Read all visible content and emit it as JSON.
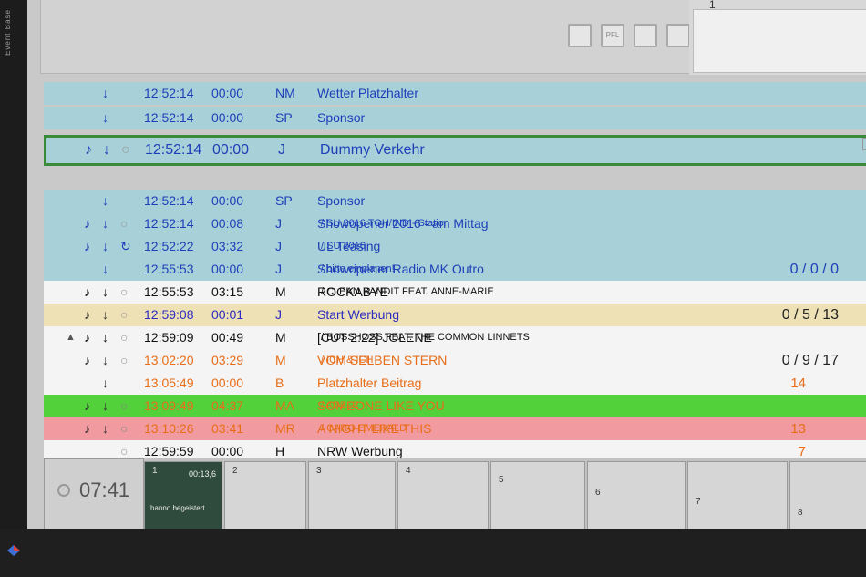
{
  "side_label": "Event Base",
  "top_buttons": [
    "",
    "PFL",
    "",
    ""
  ],
  "top_right_number": "1",
  "rows": [
    {
      "start": "12:52:14",
      "dur": "00:00",
      "type": "NM",
      "title": "Wetter Platzhalter",
      "artist": "",
      "count": ""
    },
    {
      "start": "12:52:14",
      "dur": "00:00",
      "type": "SP",
      "title": "Sponsor",
      "artist": "",
      "count": ""
    },
    {
      "start": "12:52:14",
      "dur": "00:00",
      "type": "J",
      "title": "Dummy Verkehr",
      "artist": "",
      "count": ""
    },
    {
      "start": "12:52:14",
      "dur": "00:00",
      "type": "SP",
      "title": "Sponsor",
      "artist": "",
      "count": ""
    },
    {
      "start": "12:52:14",
      "dur": "00:08",
      "type": "J",
      "title": "Showopener 2016 - am Mittag",
      "artist": "/ SU 2016 TOH/IND - Station",
      "count": ""
    },
    {
      "start": "12:52:22",
      "dur": "03:32",
      "type": "J",
      "title": "UL Teasing",
      "artist": "/ SU 2016",
      "count": ""
    },
    {
      "start": "12:55:53",
      "dur": "00:00",
      "type": "J",
      "title": "Showopener Radio MK Outro",
      "artist": "/ bitte einplanen!",
      "count": "0 / 0 / 0"
    },
    {
      "start": "12:55:53",
      "dur": "03:15",
      "type": "M",
      "title": "ROCKABYE",
      "artist": "/ CLEAN BANDIT FEAT. ANNE-MARIE",
      "count": ""
    },
    {
      "start": "12:59:08",
      "dur": "00:01",
      "type": "J",
      "title": "Start Werbung",
      "artist": "",
      "count": "0 / 5 / 13"
    },
    {
      "start": "12:59:09",
      "dur": "00:49",
      "type": "M",
      "title": "[CUT 2:22] JOLENE",
      "artist": "/ BOSSHOSS FEAT. THE COMMON LINNETS",
      "count": ""
    },
    {
      "start": "13:02:20",
      "dur": "03:29",
      "type": "M",
      "title": "VOM SELBEN STERN",
      "artist": "/ ICH & ICH",
      "count": "0 / 9 / 17"
    },
    {
      "start": "13:05:49",
      "dur": "00:00",
      "type": "B",
      "title": "Platzhalter Beitrag",
      "artist": "",
      "count": "14"
    },
    {
      "start": "13:09:49",
      "dur": "04:37",
      "type": "MA",
      "title": "SOMEONE LIKE YOU",
      "artist": "/ ADELE",
      "count": ""
    },
    {
      "start": "13:10:26",
      "dur": "03:41",
      "type": "MR",
      "title": "A NIGHT LIKE THIS",
      "artist": "/ CARO EMERALD",
      "count": "13"
    },
    {
      "start": "12:59:59",
      "dur": "00:00",
      "type": "H",
      "title": "NRW Werbung",
      "artist": "",
      "count": "7"
    }
  ],
  "clock": "07:41",
  "carts": [
    {
      "n": "1",
      "time": "00:13,6",
      "label": "hanno begeistert"
    },
    {
      "n": "2"
    },
    {
      "n": "3"
    },
    {
      "n": "4"
    },
    {
      "n": "5"
    },
    {
      "n": "6"
    },
    {
      "n": "7"
    },
    {
      "n": "8"
    }
  ]
}
